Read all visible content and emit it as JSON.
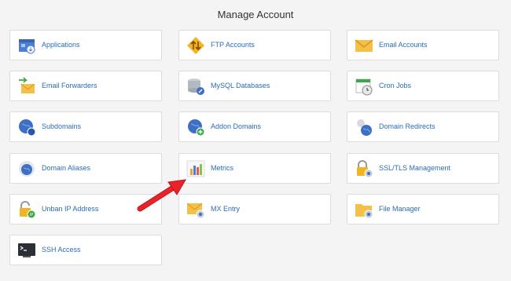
{
  "header": {
    "title": "Manage Account"
  },
  "tiles": [
    {
      "label": "Applications",
      "icon": "applications-icon"
    },
    {
      "label": "FTP Accounts",
      "icon": "ftp-accounts-icon"
    },
    {
      "label": "Email Accounts",
      "icon": "email-accounts-icon"
    },
    {
      "label": "Email Forwarders",
      "icon": "email-forwarders-icon"
    },
    {
      "label": "MySQL Databases",
      "icon": "mysql-databases-icon"
    },
    {
      "label": "Cron Jobs",
      "icon": "cron-jobs-icon"
    },
    {
      "label": "Subdomains",
      "icon": "subdomains-icon"
    },
    {
      "label": "Addon Domains",
      "icon": "addon-domains-icon"
    },
    {
      "label": "Domain Redirects",
      "icon": "domain-redirects-icon"
    },
    {
      "label": "Domain Aliases",
      "icon": "domain-aliases-icon"
    },
    {
      "label": "Metrics",
      "icon": "metrics-icon"
    },
    {
      "label": "SSL/TLS Management",
      "icon": "ssl-tls-management-icon"
    },
    {
      "label": "Unban IP Address",
      "icon": "unban-ip-address-icon"
    },
    {
      "label": "MX Entry",
      "icon": "mx-entry-icon"
    },
    {
      "label": "File Manager",
      "icon": "file-manager-icon"
    },
    {
      "label": "SSH Access",
      "icon": "ssh-access-icon"
    }
  ],
  "annotation": {
    "arrow_color": "#e8232a",
    "points_to": "Metrics"
  }
}
